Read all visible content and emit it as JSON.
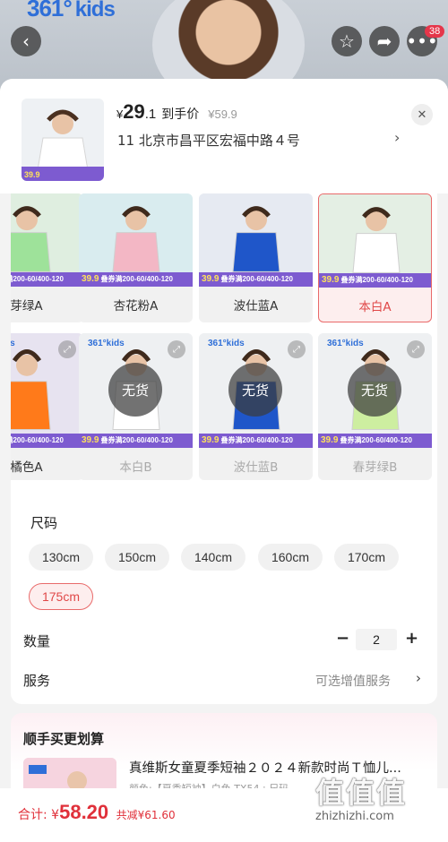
{
  "banner": {
    "brand": "361°",
    "brand_suffix": "kids",
    "badge": "38"
  },
  "icons": {
    "back": "chevron-left-icon",
    "favorite": "star-icon",
    "share": "share-icon",
    "more": "ellipsis-icon",
    "close": "close-icon"
  },
  "header": {
    "currency": "¥",
    "price_int": "29",
    "price_dec": ".1",
    "price_label": "到手价",
    "original_price": "¥59.9",
    "address": "11  北京市昌平区宏福中路４号"
  },
  "promo": {
    "price": "39.9",
    "text": "叠券满200-60/400-120"
  },
  "colors": [
    {
      "label": "芽绿A",
      "state": "available"
    },
    {
      "label": "杏花粉A",
      "state": "available"
    },
    {
      "label": "波仕蓝A",
      "state": "available"
    },
    {
      "label": "本白A",
      "state": "selected"
    },
    {
      "label": "橘色A",
      "state": "available"
    },
    {
      "label": "本白B",
      "state": "out_of_stock"
    },
    {
      "label": "波仕蓝B",
      "state": "out_of_stock"
    },
    {
      "label": "春芽绿B",
      "state": "out_of_stock"
    }
  ],
  "out_of_stock_label": "无货",
  "size": {
    "title": "尺码",
    "options": [
      "130cm",
      "150cm",
      "140cm",
      "160cm",
      "170cm",
      "175cm"
    ],
    "selected": "175cm"
  },
  "quantity": {
    "label": "数量",
    "value": "2"
  },
  "service": {
    "label": "服务",
    "value": "可选增值服务"
  },
  "recommend": {
    "title": "顺手买更划算",
    "item_name": "真维斯女童夏季短袖２０２４新款时尚Ｔ恤儿...",
    "item_sub": "颜色:【夏季短袖】白色 TX54 ; 尺码..."
  },
  "footer": {
    "total_label": "合计:",
    "currency": "¥",
    "total": "58.20",
    "saving": "共减¥61.60"
  },
  "watermark": {
    "text": "值值值",
    "url": "zhizhizhi.com"
  },
  "accent": "#e04848"
}
